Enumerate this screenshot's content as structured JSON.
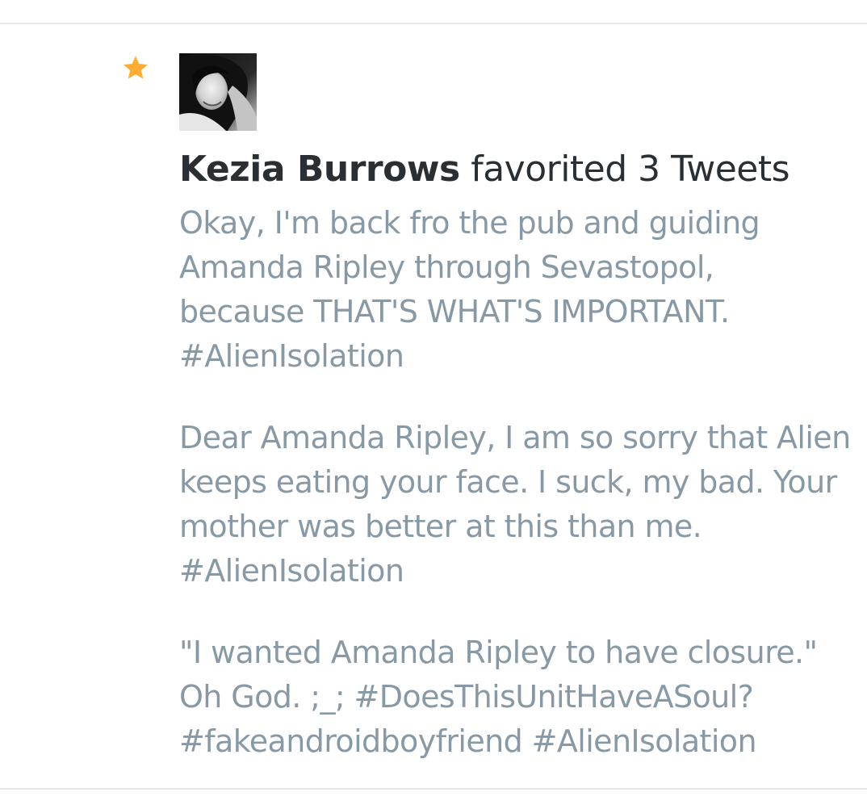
{
  "notification": {
    "icon": "star-icon",
    "accent_color": "#ffac33",
    "user_name": "Kezia Burrows",
    "action_text": "favorited 3 Tweets",
    "tweets": [
      {
        "lines": [
          "Okay, I'm back fro the pub and guiding",
          "Amanda Ripley through Sevastopol,",
          "because THAT'S WHAT'S IMPORTANT.",
          "#AlienIsolation"
        ]
      },
      {
        "lines": [
          "Dear Amanda Ripley, I am so sorry that Alien",
          "keeps eating your face. I suck, my bad. Your",
          "mother was better at this than me.",
          "#AlienIsolation"
        ]
      },
      {
        "lines": [
          "\"I wanted Amanda Ripley to have closure.\"",
          "Oh God. ;_; #DoesThisUnitHaveASoul?",
          "#fakeandroidboyfriend #AlienIsolation"
        ]
      }
    ]
  }
}
